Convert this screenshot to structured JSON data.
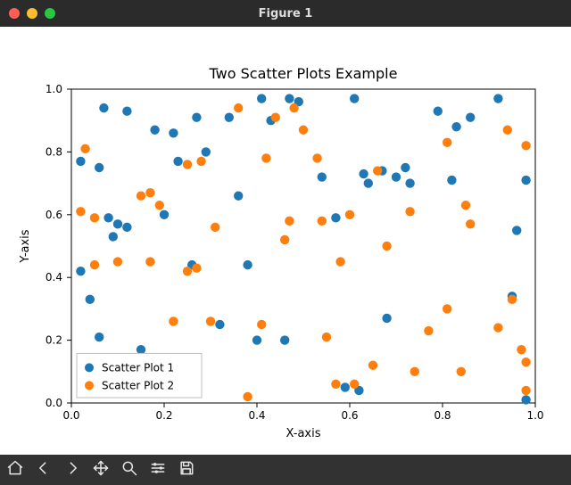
{
  "window": {
    "title": "Figure 1"
  },
  "chart_data": {
    "type": "scatter",
    "title": "Two Scatter Plots Example",
    "xlabel": "X-axis",
    "ylabel": "Y-axis",
    "xlim": [
      0.0,
      1.0
    ],
    "ylim": [
      0.0,
      1.0
    ],
    "xticks": [
      0.0,
      0.2,
      0.4,
      0.6,
      0.8,
      1.0
    ],
    "yticks": [
      0.0,
      0.2,
      0.4,
      0.6,
      0.8,
      1.0
    ],
    "legend_position": "lower left",
    "series": [
      {
        "name": "Scatter Plot 1",
        "color": "#1f77b4",
        "points": [
          [
            0.02,
            0.42
          ],
          [
            0.02,
            0.77
          ],
          [
            0.04,
            0.33
          ],
          [
            0.06,
            0.75
          ],
          [
            0.06,
            0.21
          ],
          [
            0.07,
            0.94
          ],
          [
            0.08,
            0.59
          ],
          [
            0.09,
            0.53
          ],
          [
            0.1,
            0.57
          ],
          [
            0.12,
            0.93
          ],
          [
            0.12,
            0.56
          ],
          [
            0.15,
            0.17
          ],
          [
            0.18,
            0.87
          ],
          [
            0.2,
            0.6
          ],
          [
            0.22,
            0.86
          ],
          [
            0.23,
            0.77
          ],
          [
            0.26,
            0.44
          ],
          [
            0.27,
            0.91
          ],
          [
            0.29,
            0.8
          ],
          [
            0.32,
            0.25
          ],
          [
            0.34,
            0.91
          ],
          [
            0.36,
            0.66
          ],
          [
            0.38,
            0.44
          ],
          [
            0.4,
            0.2
          ],
          [
            0.41,
            0.97
          ],
          [
            0.43,
            0.9
          ],
          [
            0.46,
            0.2
          ],
          [
            0.47,
            0.97
          ],
          [
            0.49,
            0.96
          ],
          [
            0.54,
            0.72
          ],
          [
            0.57,
            0.59
          ],
          [
            0.59,
            0.05
          ],
          [
            0.61,
            0.97
          ],
          [
            0.62,
            0.04
          ],
          [
            0.63,
            0.73
          ],
          [
            0.64,
            0.7
          ],
          [
            0.67,
            0.74
          ],
          [
            0.68,
            0.27
          ],
          [
            0.7,
            0.72
          ],
          [
            0.72,
            0.75
          ],
          [
            0.73,
            0.7
          ],
          [
            0.79,
            0.93
          ],
          [
            0.82,
            0.71
          ],
          [
            0.83,
            0.88
          ],
          [
            0.86,
            0.91
          ],
          [
            0.92,
            0.97
          ],
          [
            0.95,
            0.34
          ],
          [
            0.96,
            0.55
          ],
          [
            0.98,
            0.71
          ],
          [
            0.98,
            0.01
          ]
        ]
      },
      {
        "name": "Scatter Plot 2",
        "color": "#ff7f0e",
        "points": [
          [
            0.02,
            0.61
          ],
          [
            0.03,
            0.81
          ],
          [
            0.05,
            0.44
          ],
          [
            0.05,
            0.59
          ],
          [
            0.1,
            0.45
          ],
          [
            0.15,
            0.66
          ],
          [
            0.17,
            0.45
          ],
          [
            0.17,
            0.67
          ],
          [
            0.19,
            0.63
          ],
          [
            0.22,
            0.26
          ],
          [
            0.25,
            0.42
          ],
          [
            0.25,
            0.76
          ],
          [
            0.27,
            0.43
          ],
          [
            0.28,
            0.77
          ],
          [
            0.3,
            0.26
          ],
          [
            0.31,
            0.56
          ],
          [
            0.36,
            0.94
          ],
          [
            0.38,
            0.02
          ],
          [
            0.41,
            0.25
          ],
          [
            0.42,
            0.78
          ],
          [
            0.44,
            0.91
          ],
          [
            0.46,
            0.52
          ],
          [
            0.47,
            0.58
          ],
          [
            0.48,
            0.94
          ],
          [
            0.5,
            0.87
          ],
          [
            0.53,
            0.78
          ],
          [
            0.54,
            0.58
          ],
          [
            0.55,
            0.21
          ],
          [
            0.57,
            0.06
          ],
          [
            0.58,
            0.45
          ],
          [
            0.6,
            0.6
          ],
          [
            0.61,
            0.06
          ],
          [
            0.65,
            0.12
          ],
          [
            0.66,
            0.74
          ],
          [
            0.68,
            0.5
          ],
          [
            0.73,
            0.61
          ],
          [
            0.74,
            0.1
          ],
          [
            0.77,
            0.23
          ],
          [
            0.81,
            0.83
          ],
          [
            0.81,
            0.3
          ],
          [
            0.84,
            0.1
          ],
          [
            0.85,
            0.63
          ],
          [
            0.86,
            0.57
          ],
          [
            0.92,
            0.24
          ],
          [
            0.94,
            0.87
          ],
          [
            0.95,
            0.33
          ],
          [
            0.97,
            0.17
          ],
          [
            0.98,
            0.13
          ],
          [
            0.98,
            0.82
          ],
          [
            0.98,
            0.04
          ]
        ]
      }
    ]
  },
  "toolbar": {
    "buttons": [
      "home",
      "back",
      "forward",
      "pan",
      "zoom",
      "configure",
      "save"
    ]
  }
}
